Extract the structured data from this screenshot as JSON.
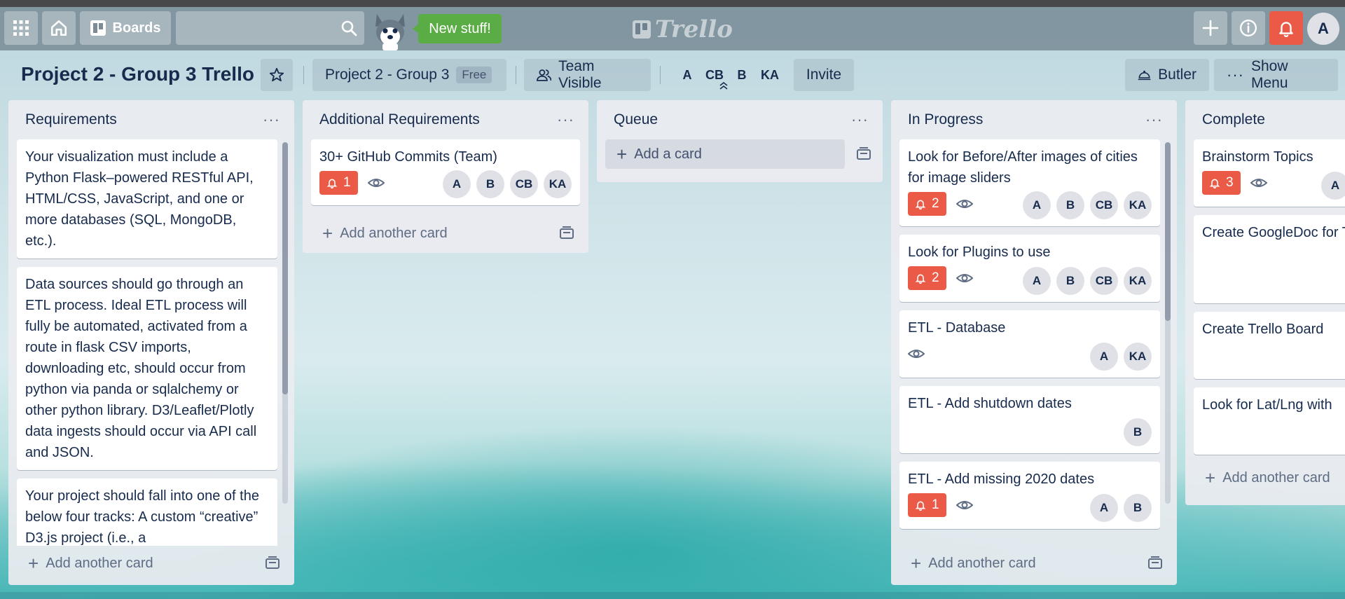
{
  "header": {
    "boards_label": "Boards",
    "new_stuff_label": "New stuff!",
    "logo_text": "Trello",
    "avatar_initial": "A",
    "notify_color": "#eb5a46"
  },
  "board": {
    "title": "Project 2 - Group 3 Trello",
    "team_name": "Project 2 - Group 3",
    "team_plan": "Free",
    "visibility_label": "Team Visible",
    "members": [
      "A",
      "CB",
      "B",
      "KA"
    ],
    "invite_label": "Invite",
    "butler_label": "Butler",
    "show_menu_label": "Show Menu"
  },
  "lists": [
    {
      "title": "Requirements",
      "add_label": "Add another card",
      "cards": [
        {
          "text": "Your visualization must include a Python Flask–powered RESTful API, HTML/CSS, JavaScript, and one or more databases (SQL, MongoDB, etc.)."
        },
        {
          "text": "Data sources should go through an ETL process. Ideal ETL process will fully be automated, activated from a route in flask CSV imports, downloading etc, should occur from python via panda or sqlalchemy or other python library. D3/Leaflet/Plotly data ingests should occur via API call and JSON."
        },
        {
          "text": "Your project should fall into one of the below four tracks: A custom “creative” D3.js project (i.e., a"
        }
      ]
    },
    {
      "title": "Additional Requirements",
      "add_label": "Add another card",
      "cards": [
        {
          "text": "30+ GitHub Commits (Team)",
          "notifications": "1",
          "members": [
            "A",
            "B",
            "CB",
            "KA"
          ]
        }
      ]
    },
    {
      "title": "Queue",
      "add_label": "Add a card"
    },
    {
      "title": "In Progress",
      "add_label": "Add another card",
      "cards": [
        {
          "text": "Look for Before/After images of cities for image sliders",
          "notifications": "2",
          "members": [
            "A",
            "B",
            "CB",
            "KA"
          ]
        },
        {
          "text": "Look for Plugins to use",
          "notifications": "2",
          "members": [
            "A",
            "B",
            "CB",
            "KA"
          ]
        },
        {
          "text": "ETL - Database",
          "members": [
            "A",
            "KA"
          ]
        },
        {
          "text": "ETL - Add shutdown dates",
          "members": [
            "B"
          ]
        },
        {
          "text": "ETL - Add missing 2020 dates",
          "notifications": "1",
          "members": [
            "A",
            "B"
          ]
        }
      ]
    },
    {
      "title": "Complete",
      "add_label": "Add another card",
      "cards": [
        {
          "text": "Brainstorm Topics",
          "notifications": "3",
          "members": [
            "A"
          ]
        },
        {
          "text": "Create GoogleDoc for Topics"
        },
        {
          "text": "Create Trello Board"
        },
        {
          "text": "Look for Lat/Lng with"
        }
      ]
    }
  ]
}
